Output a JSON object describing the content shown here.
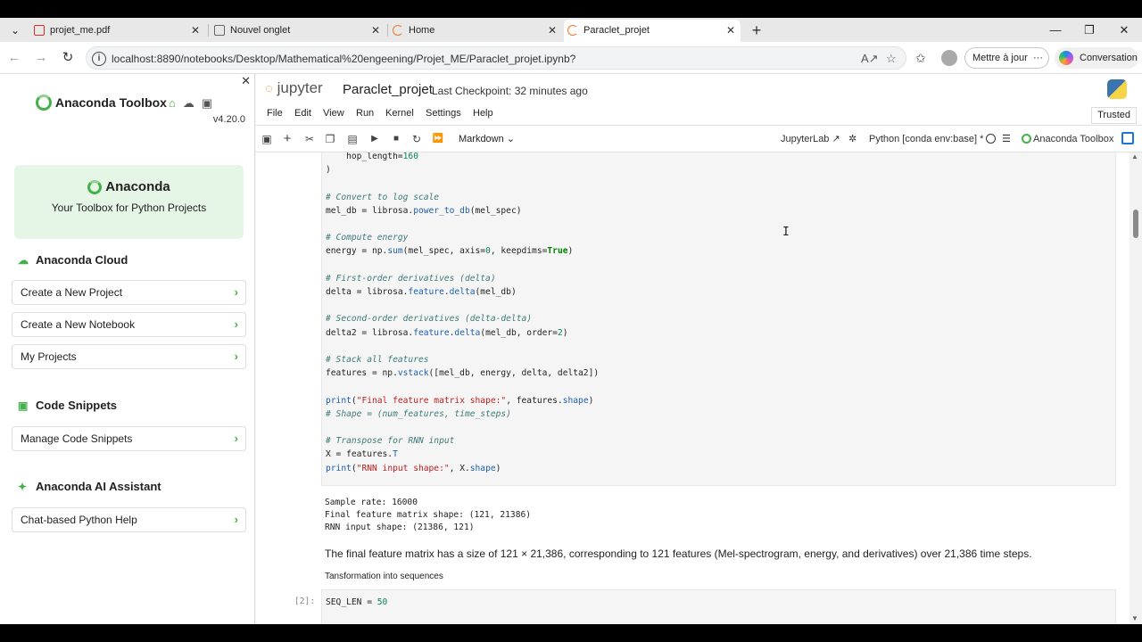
{
  "browser": {
    "tabs": [
      {
        "label": "projet_me.pdf",
        "icon": "pdf-icon",
        "color": "#d93025"
      },
      {
        "label": "Nouvel onglet",
        "icon": "page-icon",
        "color": "#666666"
      },
      {
        "label": "Home",
        "icon": "spinner-icon",
        "color": "#f37726"
      },
      {
        "label": "Paraclet_projet",
        "icon": "spinner-icon",
        "color": "#f37726"
      }
    ],
    "url": "localhost:8890/notebooks/Desktop/Mathematical%20engeening/Projet_ME/Paraclet_projet.ipynb?",
    "update_label": "Mettre à jour",
    "copilot_label": "Conversation"
  },
  "sidebar": {
    "brand": "Anaconda Toolbox",
    "version": "v4.20.0",
    "hero_title": "Anaconda",
    "hero_subtitle": "Your Toolbox for Python Projects",
    "cloud_heading": "Anaconda Cloud",
    "cloud_items": [
      "Create a New Project",
      "Create a New Notebook",
      "My Projects"
    ],
    "snippets_heading": "Code Snippets",
    "snippets_items": [
      "Manage Code Snippets"
    ],
    "ai_heading": "Anaconda AI Assistant",
    "ai_items": [
      "Chat-based Python Help"
    ]
  },
  "jupyter": {
    "logo_text": "jupyter",
    "notebook_title": "Paraclet_projet",
    "checkpoint": "Last Checkpoint: 32 minutes ago",
    "menus": [
      "File",
      "Edit",
      "View",
      "Run",
      "Kernel",
      "Settings",
      "Help"
    ],
    "trusted": "Trusted",
    "cell_type": "Markdown",
    "jupyterlab_link": "JupyterLab",
    "kernel": "Python [conda env:base] *",
    "toolbox_label": "Anaconda Toolbox"
  },
  "notebook": {
    "outputs": [
      "Sample rate: 16000",
      "Final feature matrix shape: (121, 21386)",
      "RNN input shape: (21386, 121)"
    ],
    "markdown_text": "The final feature matrix has a size of 121 × 21,386, corresponding to 121 features (Mel-spectrogram, energy, and derivatives) over 21,386 time steps.",
    "markdown_heading": "Tansformation into sequences",
    "prompt_2": "[2]:"
  }
}
